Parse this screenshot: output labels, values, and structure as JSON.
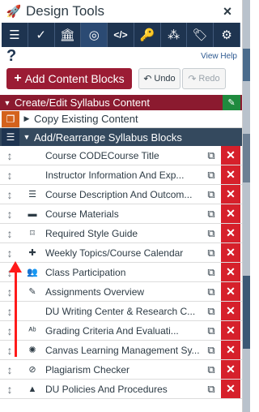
{
  "titlebar": {
    "title": "Design Tools",
    "close": "×",
    "rocket": "🚀"
  },
  "toolbar": [
    {
      "icon": "list-icon",
      "glyph": "☰"
    },
    {
      "icon": "check-icon",
      "glyph": "✓"
    },
    {
      "icon": "institution-icon",
      "glyph": "🏛"
    },
    {
      "icon": "target-icon",
      "glyph": "◎"
    },
    {
      "icon": "code-icon",
      "glyph": "</>"
    },
    {
      "icon": "key-icon",
      "glyph": "🔑"
    },
    {
      "icon": "cubes-icon",
      "glyph": "⁂"
    },
    {
      "icon": "tags-icon",
      "glyph": "🏷"
    },
    {
      "icon": "gears-icon",
      "glyph": "⚙"
    }
  ],
  "help": {
    "question": "?",
    "view_help": "View Help"
  },
  "buttons": {
    "add": "Add Content Blocks",
    "add_plus": "+",
    "undo": "Undo",
    "redo": "Redo"
  },
  "sections": {
    "create_edit": "Create/Edit Syllabus Content",
    "copy_existing": "Copy Existing Content",
    "add_rearrange": "Add/Rearrange Syllabus Blocks"
  },
  "blocks": [
    {
      "label": "Course CODECourse Title",
      "icon": ""
    },
    {
      "label": "Instructor Information And Exp...",
      "icon": ""
    },
    {
      "label": "Course Description And Outcom...",
      "icon": "☰"
    },
    {
      "label": "Course Materials",
      "icon": "▬"
    },
    {
      "label": "Required Style Guide",
      "icon": "⌑"
    },
    {
      "label": "Weekly Topics/Course Calendar",
      "icon": "✚"
    },
    {
      "label": "Class Participation",
      "icon": "👥"
    },
    {
      "label": "Assignments Overview",
      "icon": "✎"
    },
    {
      "label": "DU Writing Center & Research C...",
      "icon": ""
    },
    {
      "label": "Grading Criteria And Evaluati...",
      "icon": "ᴬᵇ"
    },
    {
      "label": "Canvas Learning Management Sy...",
      "icon": "✺"
    },
    {
      "label": "Plagiarism Checker",
      "icon": "⊘"
    },
    {
      "label": "DU Policies And Procedures",
      "icon": "▲"
    }
  ],
  "colors": {
    "accent": "#9b1c34",
    "delete": "#d6202b",
    "toolbar": "#1e3450"
  }
}
